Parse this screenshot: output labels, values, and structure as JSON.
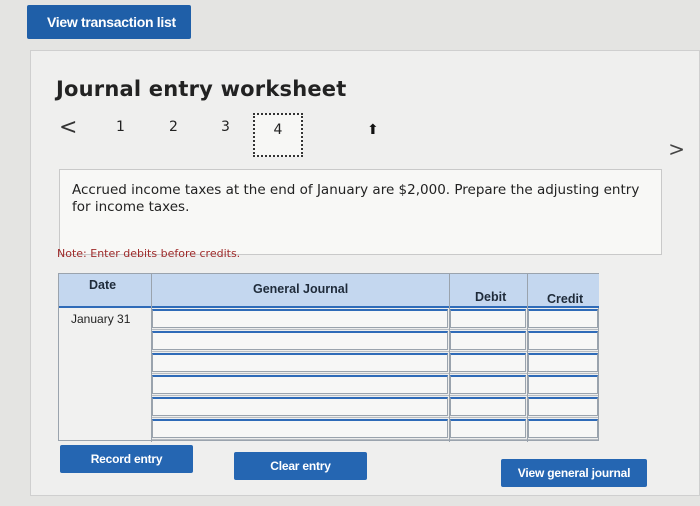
{
  "top": {
    "view_transactions_label": "View transaction list"
  },
  "worksheet": {
    "title": "Journal entry worksheet",
    "steps": [
      "1",
      "2",
      "3",
      "4"
    ],
    "active_step": "4",
    "prev_glyph": "<",
    "next_glyph": ">",
    "prompt": "Accrued income taxes at the end of January are $2,000. Prepare the adjusting entry for income taxes.",
    "note": "Note: Enter debits before credits."
  },
  "journal": {
    "headers": {
      "date": "Date",
      "general_journal": "General Journal",
      "debit": "Debit",
      "credit": "Credit"
    },
    "rows": [
      {
        "date": "January 31"
      },
      {
        "date": ""
      },
      {
        "date": ""
      },
      {
        "date": ""
      },
      {
        "date": ""
      },
      {
        "date": ""
      }
    ]
  },
  "buttons": {
    "record": "Record entry",
    "clear": "Clear entry",
    "view_journal": "View general journal"
  }
}
